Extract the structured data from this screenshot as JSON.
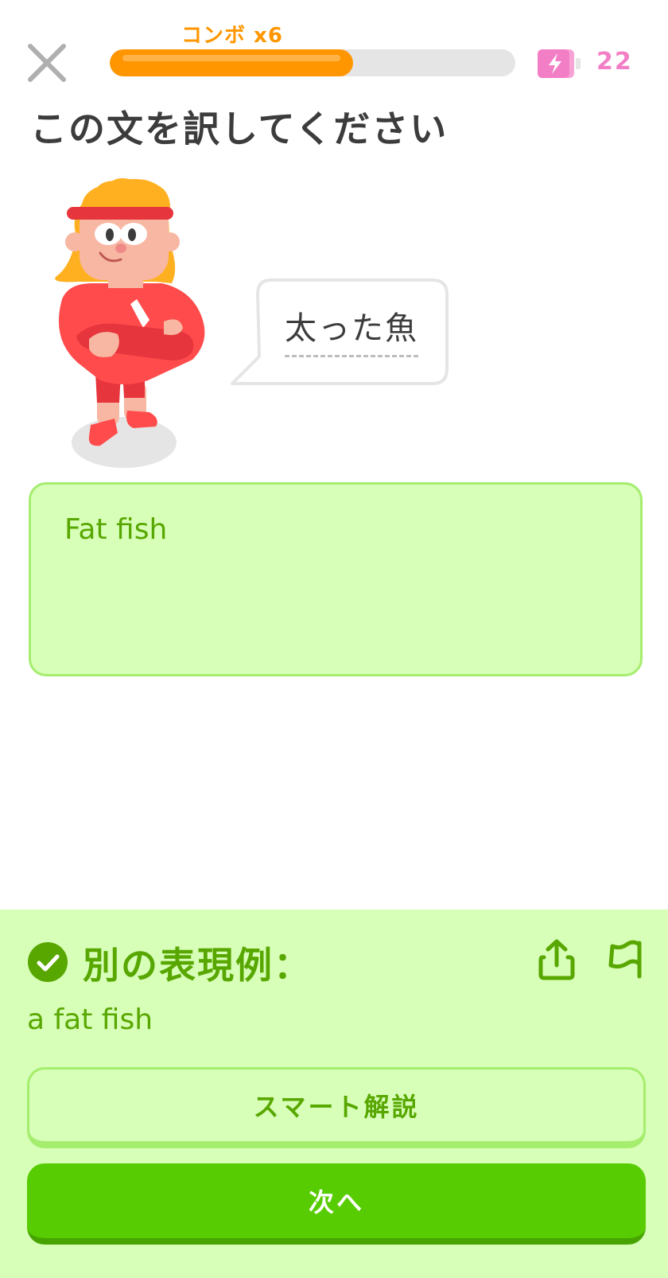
{
  "header": {
    "combo_label": "コンボ x6",
    "progress_fraction": 0.6,
    "energy_count": "22",
    "close_icon": "close-icon",
    "energy_icon": "energy-battery-icon"
  },
  "instruction": "この文を訳してください",
  "prompt": {
    "sentence": "太った魚"
  },
  "answer": {
    "text": "Fat fish"
  },
  "feedback": {
    "title": "別の表現例：",
    "alternative": "a fat fish",
    "explain_label": "スマート解説",
    "next_label": "次へ",
    "icons": [
      "check-circle-icon",
      "share-icon",
      "flag-icon"
    ]
  },
  "colors": {
    "accent_orange": "#ff9600",
    "energy_pink": "#f27fc6",
    "success_green": "#58cc02",
    "success_text": "#58a700",
    "success_bg": "#d7ffb8",
    "success_border": "#a5ed6e"
  }
}
